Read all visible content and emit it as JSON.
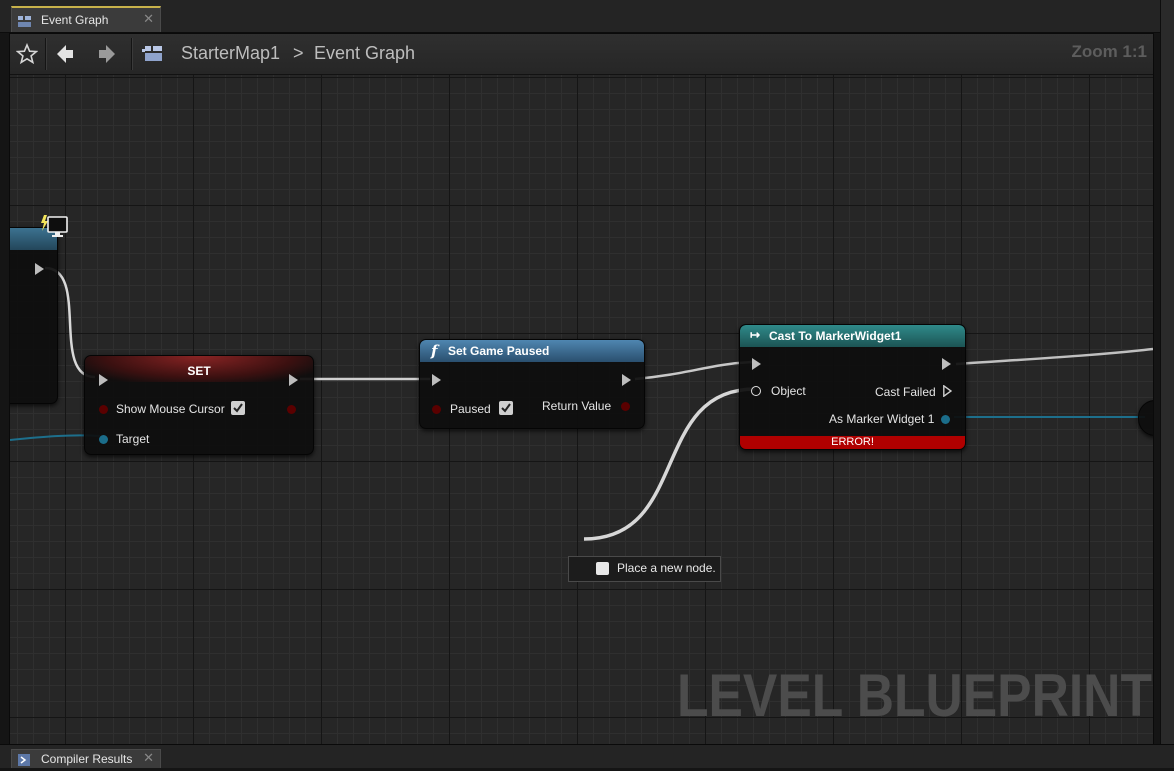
{
  "tabs": {
    "event_graph": {
      "label": "Event Graph",
      "close": "✕"
    },
    "compiler_results": {
      "label": "Compiler Results",
      "close": "✕"
    }
  },
  "toolbar": {
    "breadcrumb": [
      "StarterMap1",
      "Event Graph"
    ],
    "separator": ">",
    "zoom": "Zoom 1:1"
  },
  "nodes": {
    "set": {
      "title": "SET",
      "pins": {
        "show_mouse_cursor": "Show Mouse Cursor",
        "target": "Target"
      },
      "show_mouse_cursor_checked": true
    },
    "set_game_paused": {
      "title": "Set Game Paused",
      "pins": {
        "paused": "Paused",
        "return_value": "Return Value"
      },
      "paused_checked": true
    },
    "cast": {
      "title": "Cast To MarkerWidget1",
      "pins": {
        "object": "Object",
        "cast_failed": "Cast Failed",
        "as_marker_widget": "As Marker Widget 1"
      },
      "error": "ERROR!"
    }
  },
  "context_hint": "Place a new node.",
  "watermark": "LEVEL BLUEPRINT",
  "colors": {
    "set_header": "#7a1f1f",
    "function_header": "#3c6e96",
    "cast_header": "#1f6b6b",
    "error": "#b00000",
    "bool_pin": "#8a0000",
    "object_pin": "#1d8fb4",
    "exec_wire": "#d8d8d8"
  }
}
